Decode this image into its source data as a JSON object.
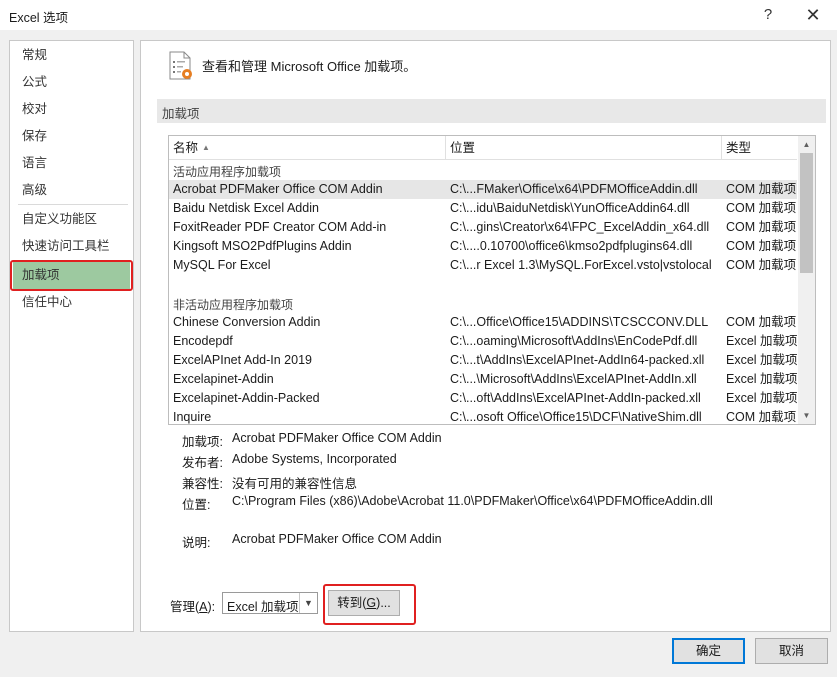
{
  "window": {
    "title": "Excel 选项",
    "help_icon": "?",
    "close_icon": "✕"
  },
  "nav": {
    "items": [
      {
        "label": "常规"
      },
      {
        "label": "公式"
      },
      {
        "label": "校对"
      },
      {
        "label": "保存"
      },
      {
        "label": "语言"
      },
      {
        "label": "高级"
      },
      {
        "label": "自定义功能区"
      },
      {
        "label": "快速访问工具栏"
      },
      {
        "label": "加载项",
        "active": true
      },
      {
        "label": "信任中心"
      }
    ],
    "active_color": "#9dc9a0"
  },
  "header": {
    "text": "查看和管理 Microsoft Office 加载项。"
  },
  "section": {
    "label": "加载项"
  },
  "list": {
    "columns": [
      "名称",
      "位置",
      "类型"
    ],
    "sort_indicator": "▲",
    "groups": [
      {
        "label": "活动应用程序加载项",
        "rows": [
          {
            "name": "Acrobat PDFMaker Office COM Addin",
            "location": "C:\\...FMaker\\Office\\x64\\PDFMOfficeAddin.dll",
            "type": "COM 加载项",
            "selected": true
          },
          {
            "name": "Baidu Netdisk Excel Addin",
            "location": "C:\\...idu\\BaiduNetdisk\\YunOfficeAddin64.dll",
            "type": "COM 加载项"
          },
          {
            "name": "FoxitReader PDF Creator COM Add-in",
            "location": "C:\\...gins\\Creator\\x64\\FPC_ExcelAddin_x64.dll",
            "type": "COM 加载项"
          },
          {
            "name": "Kingsoft MSO2PdfPlugins Addin",
            "location": "C:\\....0.10700\\office6\\kmso2pdfplugins64.dll",
            "type": "COM 加载项"
          },
          {
            "name": "MySQL For Excel",
            "location": "C:\\...r Excel 1.3\\MySQL.ForExcel.vsto|vstolocal",
            "type": "COM 加载项"
          }
        ]
      },
      {
        "label": "非活动应用程序加载项",
        "rows": [
          {
            "name": "Chinese Conversion Addin",
            "location": "C:\\...Office\\Office15\\ADDINS\\TCSCCONV.DLL",
            "type": "COM 加载项"
          },
          {
            "name": "Encodepdf",
            "location": "C:\\...oaming\\Microsoft\\AddIns\\EnCodePdf.dll",
            "type": "Excel 加载项"
          },
          {
            "name": "ExcelAPInet Add-In 2019",
            "location": "C:\\...t\\AddIns\\ExcelAPInet-AddIn64-packed.xll",
            "type": "Excel 加载项"
          },
          {
            "name": "Excelapinet-Addin",
            "location": "C:\\...\\Microsoft\\AddIns\\ExcelAPInet-AddIn.xll",
            "type": "Excel 加载项"
          },
          {
            "name": "Excelapinet-Addin-Packed",
            "location": "C:\\...oft\\AddIns\\ExcelAPInet-AddIn-packed.xll",
            "type": "Excel 加载项"
          },
          {
            "name": "Inquire",
            "location": "C:\\...osoft Office\\Office15\\DCF\\NativeShim.dll",
            "type": "COM 加载项"
          }
        ]
      }
    ]
  },
  "details": {
    "addin_label": "加载项:",
    "addin_value": "Acrobat PDFMaker Office COM Addin",
    "publisher_label": "发布者:",
    "publisher_value": "Adobe Systems, Incorporated",
    "compat_label": "兼容性:",
    "compat_value": "没有可用的兼容性信息",
    "location_label": "位置:",
    "location_value": "C:\\Program Files (x86)\\Adobe\\Acrobat 11.0\\PDFMaker\\Office\\x64\\PDFMOfficeAddin.dll",
    "desc_label": "说明:",
    "desc_value": "Acrobat PDFMaker Office COM Addin"
  },
  "manage": {
    "label_prefix": "管理(",
    "label_key": "A",
    "label_suffix": "):",
    "selected": "Excel 加载项",
    "go_prefix": "转到(",
    "go_key": "G",
    "go_suffix": ")..."
  },
  "footer": {
    "ok": "确定",
    "cancel": "取消"
  },
  "colors": {
    "highlight_red": "#e02020",
    "primary_border": "#0078d7"
  }
}
